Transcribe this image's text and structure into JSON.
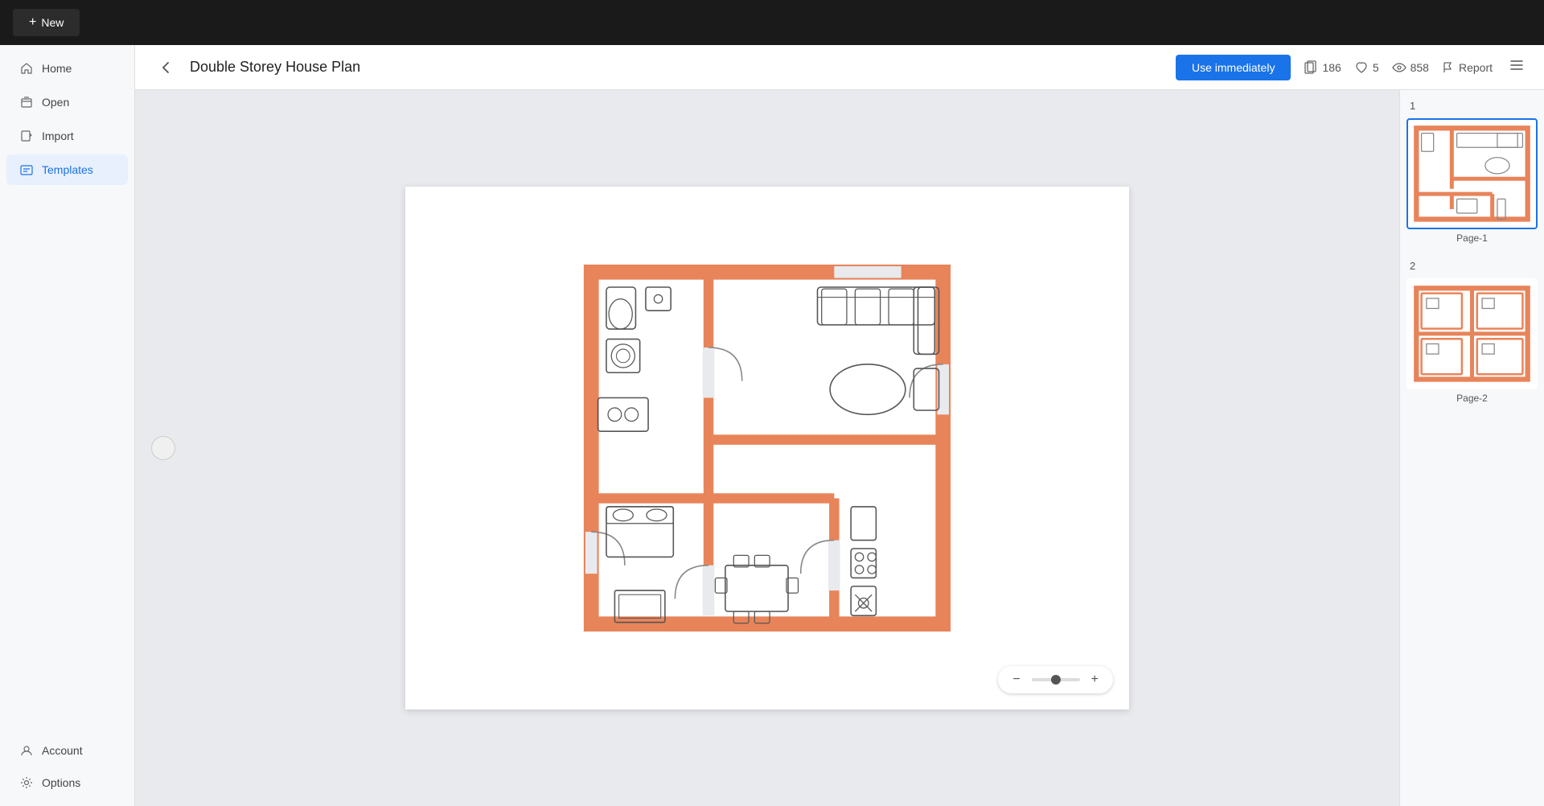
{
  "topbar": {
    "new_label": "New"
  },
  "sidebar": {
    "items": [
      {
        "id": "home",
        "label": "Home",
        "icon": "home-icon"
      },
      {
        "id": "open",
        "label": "Open",
        "icon": "open-icon"
      },
      {
        "id": "import",
        "label": "Import",
        "icon": "import-icon"
      },
      {
        "id": "templates",
        "label": "Templates",
        "icon": "templates-icon",
        "active": true
      }
    ],
    "bottom_items": [
      {
        "id": "account",
        "label": "Account",
        "icon": "account-icon"
      },
      {
        "id": "options",
        "label": "Options",
        "icon": "options-icon"
      }
    ]
  },
  "header": {
    "title": "Double Storey House Plan",
    "use_immediately": "Use immediately",
    "pages_count": "186",
    "likes_count": "5",
    "views_count": "858",
    "report_label": "Report"
  },
  "pages": [
    {
      "number": "1",
      "label": "Page-1",
      "selected": true
    },
    {
      "number": "2",
      "label": "Page-2",
      "selected": false
    }
  ],
  "zoom": {
    "minus": "−",
    "plus": "+"
  },
  "icons": {
    "home": "⌂",
    "open": "📄",
    "import": "📥",
    "templates": "💬",
    "account": "⚙",
    "options": "⚙",
    "pages": "⧉",
    "heart": "♡",
    "eye": "👁",
    "flag": "⚑",
    "menu": "≡",
    "back": "‹"
  }
}
